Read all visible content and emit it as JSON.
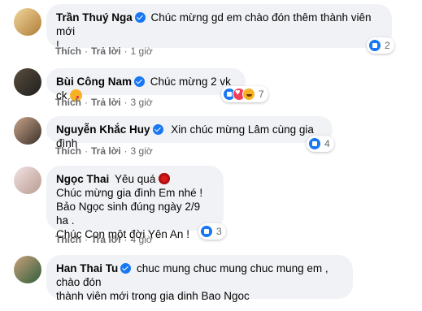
{
  "comments": [
    {
      "name": "Trần Thuý Nga",
      "verified": true,
      "lines": [
        "Chúc mừng gd em chào đón thêm thành viên mới",
        "!"
      ],
      "actions": {
        "like": "Thích",
        "reply": "Trả lời",
        "time": "1 giờ"
      },
      "reactions": {
        "icons": [
          "like"
        ],
        "count": "2"
      },
      "avatar_colors": [
        "#d8b45a",
        "#b07c3a"
      ]
    },
    {
      "name": "Bùi Công Nam",
      "verified": true,
      "lines": [
        "Chúc mừng 2 vk ck"
      ],
      "emoji": "kiss-face-icon",
      "actions": {
        "like": "Thích",
        "reply": "Trả lời",
        "time": "3 giờ"
      },
      "reactions": {
        "icons": [
          "like",
          "love",
          "haha"
        ],
        "count": "7"
      },
      "avatar_colors": [
        "#2b2b2b",
        "#7a6a55"
      ]
    },
    {
      "name": "Nguyễn Khắc Huy",
      "verified": true,
      "lines": [
        "Xin chúc mừng Lâm cùng gia đình"
      ],
      "actions": {
        "like": "Thích",
        "reply": "Trả lời",
        "time": "3 giờ"
      },
      "reactions": {
        "icons": [
          "like"
        ],
        "count": "4"
      },
      "avatar_colors": [
        "#3a2f2a",
        "#c9a58a"
      ]
    },
    {
      "name": "Ngọc Thai",
      "verified": false,
      "lines": [
        "Yêu quá",
        "Chúc mừng gia đình Em nhé !",
        "Bảo Ngọc sinh đúng ngày 2/9 ha .",
        "Chúc Con một đời Yên An !"
      ],
      "emoji": "rose-icon",
      "actions": {
        "like": "Thích",
        "reply": "Trả lời",
        "time": "4 giờ"
      },
      "reactions": {
        "icons": [
          "like"
        ],
        "count": "3"
      },
      "avatar_colors": [
        "#e9d6d6",
        "#b89a8f"
      ]
    },
    {
      "name": "Han Thai Tu",
      "verified": true,
      "lines": [
        "chuc mung chuc mung chuc mung em , chào đón",
        "thành viên mới trong gia dinh Bao Ngoc"
      ],
      "actions": {
        "like": "Thích",
        "reply": "Trả lời",
        "time": ""
      },
      "avatar_colors": [
        "#2e5d3a",
        "#caa27c"
      ]
    }
  ],
  "colors": {
    "bubble": "#f0f2f5",
    "link": "#65676b",
    "verified": "#1877f2"
  }
}
